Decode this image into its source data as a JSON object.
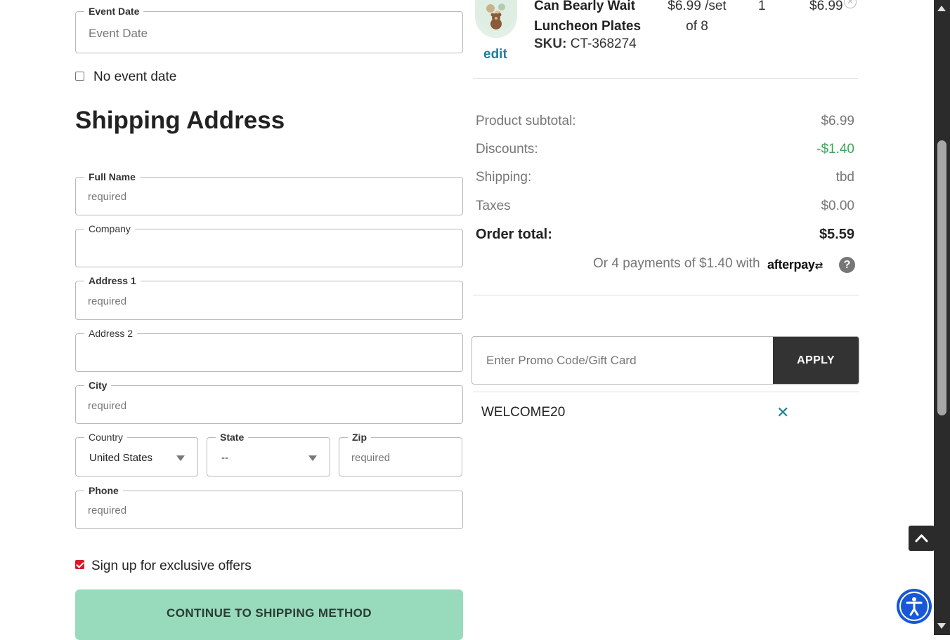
{
  "event_date": {
    "legend": "Event Date",
    "placeholder": "Event Date",
    "no_event_label": "No event date",
    "no_event_checked": false
  },
  "shipping": {
    "title": "Shipping Address",
    "fields": {
      "full_name": {
        "label": "Full Name",
        "placeholder": "required"
      },
      "company": {
        "label": "Company",
        "placeholder": ""
      },
      "address1": {
        "label": "Address 1",
        "placeholder": "required"
      },
      "address2": {
        "label": "Address 2",
        "placeholder": ""
      },
      "city": {
        "label": "City",
        "placeholder": "required"
      },
      "country": {
        "label": "Country",
        "value": "United States"
      },
      "state": {
        "label": "State",
        "value": "--"
      },
      "zip": {
        "label": "Zip",
        "placeholder": "required"
      },
      "phone": {
        "label": "Phone",
        "placeholder": "required"
      }
    },
    "offers_label": "Sign up for exclusive offers",
    "offers_checked": true,
    "continue_button": "CONTINUE TO SHIPPING METHOD"
  },
  "cart_item": {
    "name_line1": "Can Bearly Wait",
    "name_line2": "Luncheon Plates",
    "sku_label": "SKU:",
    "sku_value": "CT-368274",
    "edit_label": "edit",
    "price_line1": "$6.99 /set",
    "price_line2": "of 8",
    "quantity": "1",
    "total": "$6.99"
  },
  "summary": {
    "product_subtotal_label": "Product subtotal:",
    "product_subtotal_value": "$6.99",
    "discounts_label": "Discounts:",
    "discounts_value": "-$1.40",
    "shipping_label": "Shipping:",
    "shipping_value": "tbd",
    "taxes_label": "Taxes",
    "taxes_value": "$0.00",
    "order_total_label": "Order total:",
    "order_total_value": "$5.59",
    "afterpay_text": "Or 4 payments of $1.40 with",
    "afterpay_brand": "afterpay"
  },
  "promo": {
    "placeholder": "Enter Promo Code/Gift Card",
    "apply_label": "APPLY",
    "applied_code": "WELCOME20"
  },
  "colors": {
    "discount_green": "#3aa655",
    "edit_link": "#1f7f9a",
    "cta_bg": "#98dbbc",
    "accessibility_blue": "#1757d8"
  },
  "icons": {
    "remove_code": "close-icon",
    "remove_item": "close-circle-icon",
    "afterpay_help": "question-circle-icon",
    "back_to_top": "chevron-up-icon",
    "accessibility": "accessibility-icon",
    "product_thumbnail": "teddy-bear-balloons-icon"
  }
}
